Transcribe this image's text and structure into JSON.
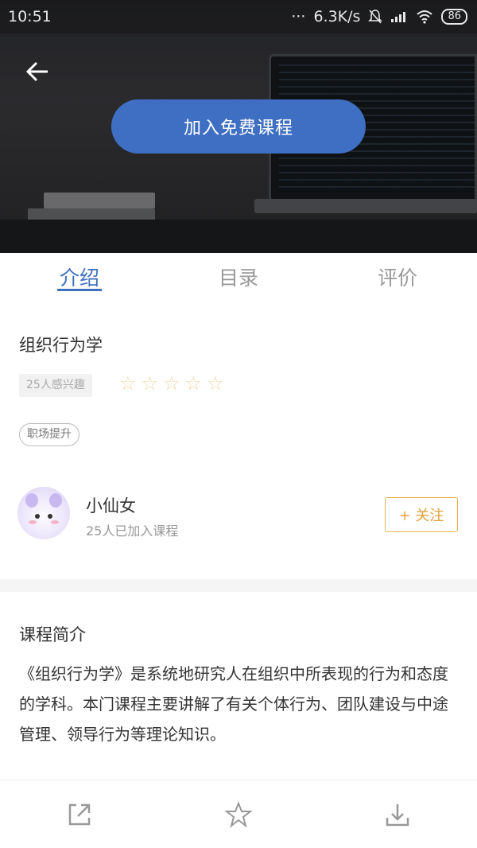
{
  "status_bar": {
    "time": "10:51",
    "network_speed": "6.3K/s",
    "battery": "86"
  },
  "hero": {
    "join_button": "加入免费课程"
  },
  "tabs": [
    {
      "label": "介绍",
      "active": true
    },
    {
      "label": "目录",
      "active": false
    },
    {
      "label": "评价",
      "active": false
    }
  ],
  "course": {
    "title": "组织行为学",
    "interest": "25人感兴趣",
    "rating_stars": 0,
    "rating_max": 5,
    "tag": "职场提升"
  },
  "author": {
    "name": "小仙女",
    "joined": "25人已加入课程",
    "follow_label": "+ 关注"
  },
  "intro": {
    "section_title": "课程简介",
    "body": "《组织行为学》是系统地研究人在组织中所表现的行为和态度的学科。本门课程主要讲解了有关个体行为、团队建设与中途管理、领导行为等理论知识。"
  },
  "colors": {
    "accent": "#3d6fbf",
    "follow": "#e3a23a",
    "star_empty": "#f0d9a8"
  },
  "bottom_bar": {
    "icons": [
      "share-icon",
      "star-icon",
      "download-icon"
    ]
  }
}
